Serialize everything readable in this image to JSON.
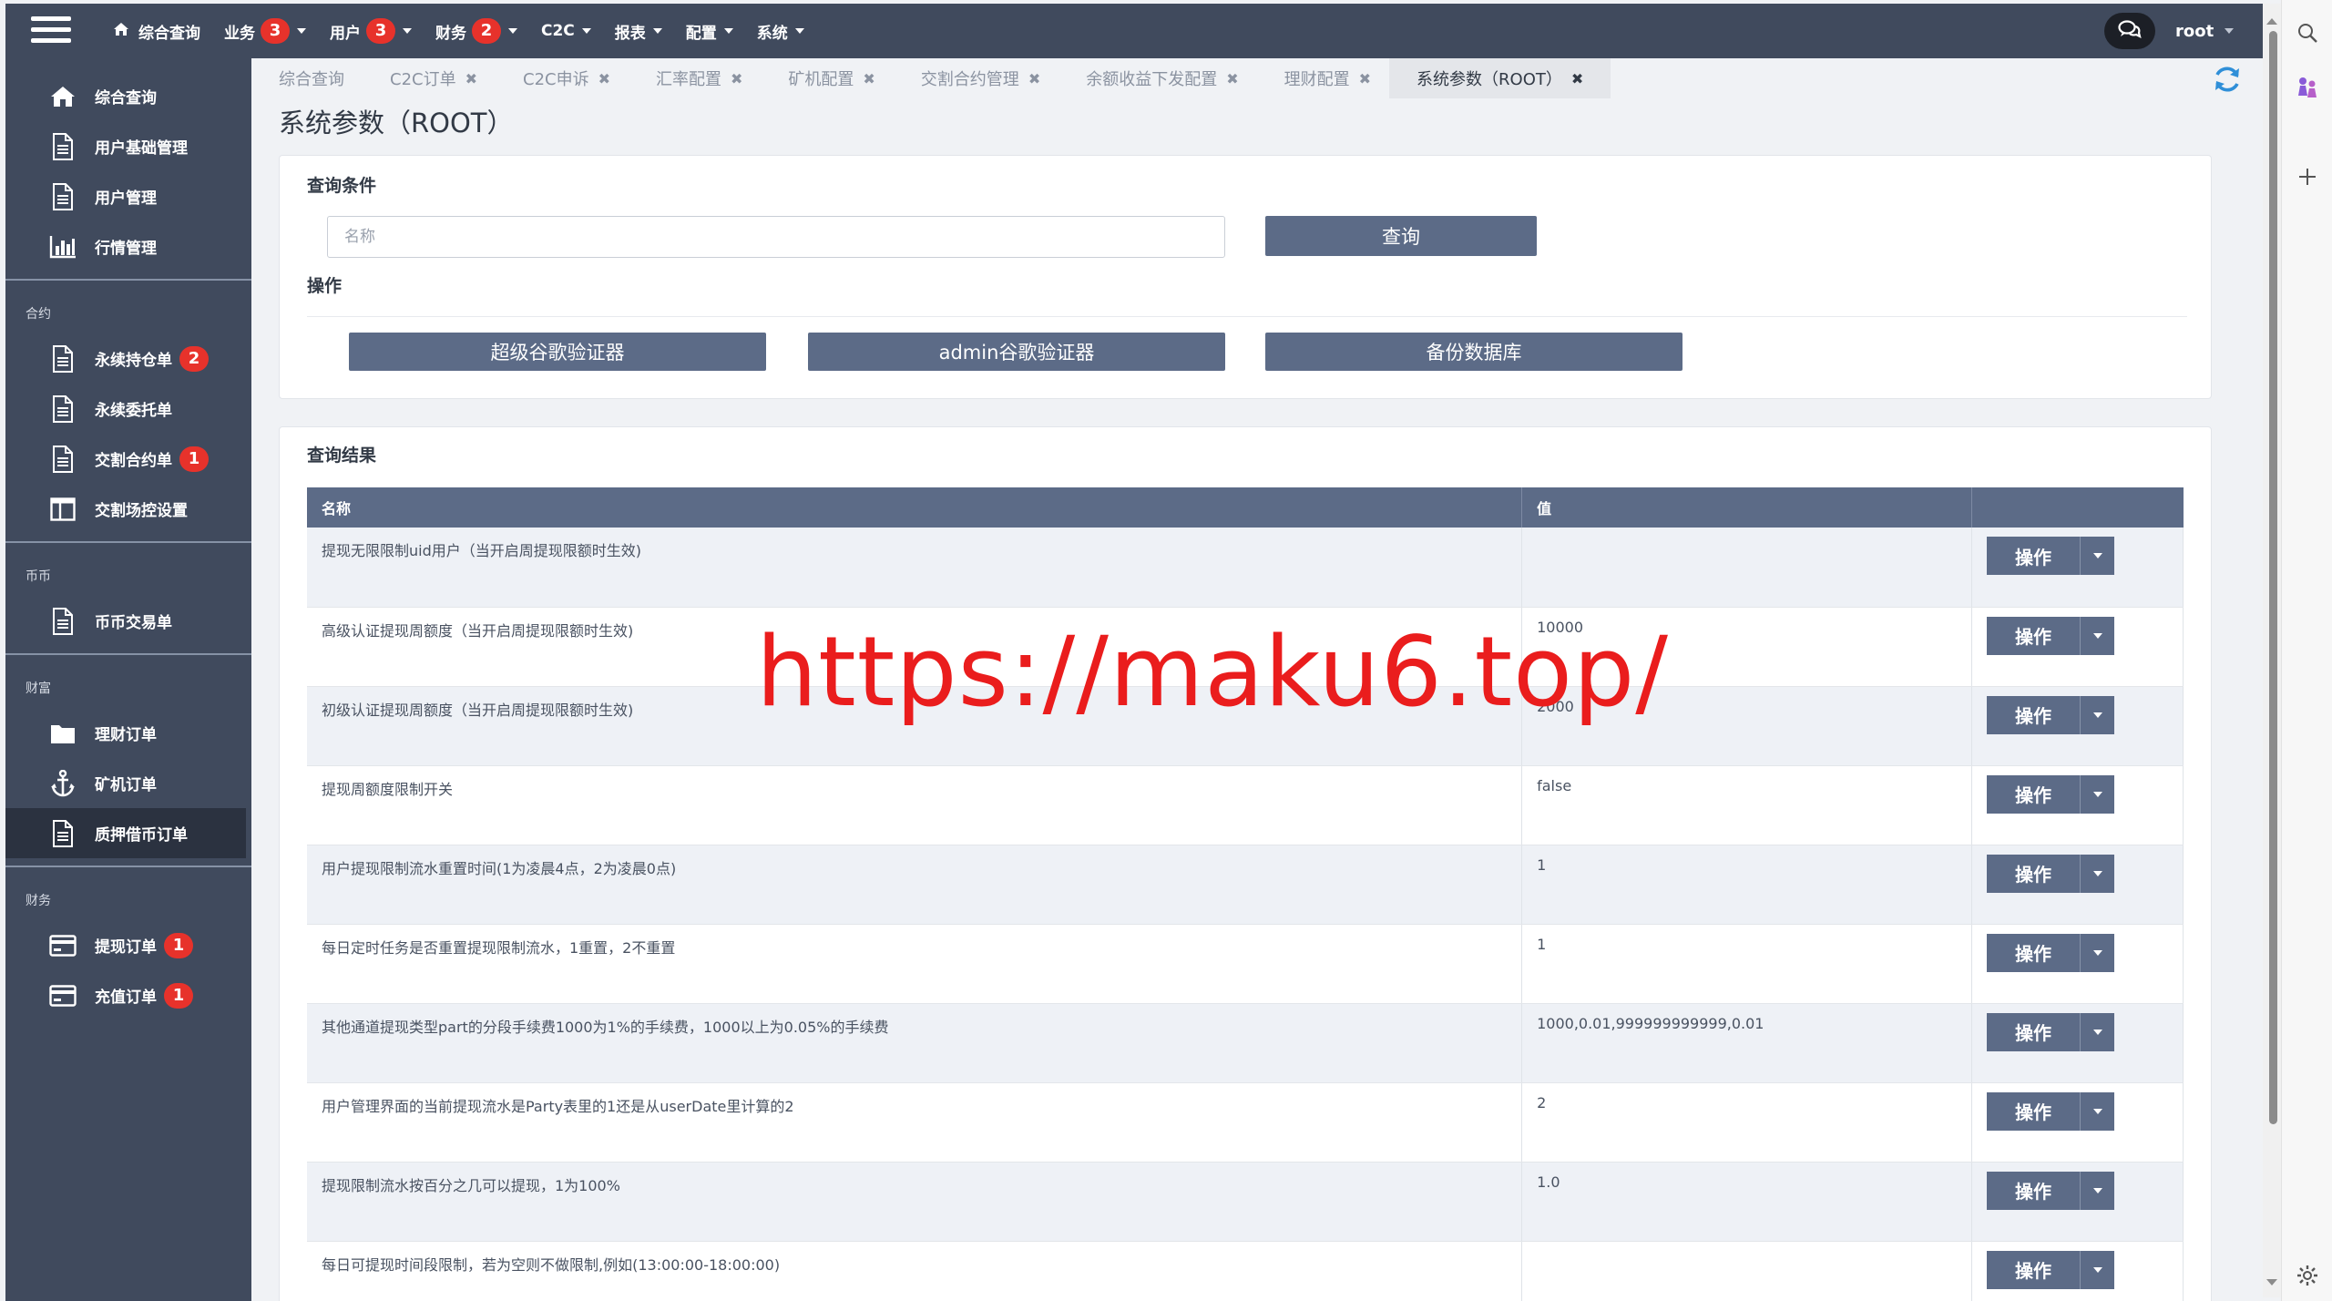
{
  "topnav": {
    "home_label": "综合查询",
    "items": [
      {
        "label": "业务",
        "badge": "3"
      },
      {
        "label": "用户",
        "badge": "3"
      },
      {
        "label": "财务",
        "badge": "2"
      },
      {
        "label": "C2C"
      },
      {
        "label": "报表"
      },
      {
        "label": "配置"
      },
      {
        "label": "系统"
      }
    ],
    "user": "root"
  },
  "sidebar": {
    "top_items": [
      {
        "label": "综合查询",
        "icon": "home-icon"
      },
      {
        "label": "用户基础管理",
        "icon": "document-icon"
      },
      {
        "label": "用户管理",
        "icon": "document-icon"
      },
      {
        "label": "行情管理",
        "icon": "bar-chart-icon"
      }
    ],
    "sections": [
      {
        "title": "合约",
        "items": [
          {
            "label": "永续持仓单",
            "icon": "document-icon",
            "badge": "2"
          },
          {
            "label": "永续委托单",
            "icon": "document-icon"
          },
          {
            "label": "交割合约单",
            "icon": "document-icon",
            "badge": "1"
          },
          {
            "label": "交割场控设置",
            "icon": "columns-icon"
          }
        ]
      },
      {
        "title": "币币",
        "items": [
          {
            "label": "币币交易单",
            "icon": "document-icon"
          }
        ]
      },
      {
        "title": "财富",
        "items": [
          {
            "label": "理财订单",
            "icon": "folder-icon"
          },
          {
            "label": "矿机订单",
            "icon": "anchor-icon"
          },
          {
            "label": "质押借币订单",
            "icon": "document-icon",
            "active": true
          }
        ]
      },
      {
        "title": "财务",
        "items": [
          {
            "label": "提现订单",
            "icon": "credit-card-icon",
            "badge": "1"
          },
          {
            "label": "充值订单",
            "icon": "credit-card-icon",
            "badge": "1"
          }
        ]
      }
    ]
  },
  "tabs": [
    {
      "label": "综合查询"
    },
    {
      "label": "C2C订单"
    },
    {
      "label": "C2C申诉"
    },
    {
      "label": "汇率配置"
    },
    {
      "label": "矿机配置"
    },
    {
      "label": "交割合约管理"
    },
    {
      "label": "余额收益下发配置"
    },
    {
      "label": "理财配置"
    },
    {
      "label": "系统参数（ROOT）",
      "active": true
    }
  ],
  "page_title": "系统参数（ROOT）",
  "query": {
    "title": "查询条件",
    "name_placeholder": "名称",
    "name_value": "",
    "search_label": "查询",
    "ops_title": "操作",
    "buttons": [
      "超级谷歌验证器",
      "admin谷歌验证器",
      "备份数据库"
    ]
  },
  "results": {
    "title": "查询结果",
    "columns": [
      "名称",
      "值",
      ""
    ],
    "action_label": "操作",
    "rows": [
      {
        "name": "提现无限限制uid用户（当开启周提现限额时生效)",
        "value": ""
      },
      {
        "name": "高级认证提现周额度（当开启周提现限额时生效)",
        "value": "10000"
      },
      {
        "name": "初级认证提现周额度（当开启周提现限额时生效)",
        "value": "2000"
      },
      {
        "name": "提现周额度限制开关",
        "value": "false"
      },
      {
        "name": "用户提现限制流水重置时间(1为凌晨4点，2为凌晨0点)",
        "value": "1"
      },
      {
        "name": "每日定时任务是否重置提现限制流水，1重置，2不重置",
        "value": "1"
      },
      {
        "name": "其他通道提现类型part的分段手续费1000为1%的手续费，1000以上为0.05%的手续费",
        "value": "1000,0.01,999999999999,0.01"
      },
      {
        "name": "用户管理界面的当前提现流水是Party表里的1还是从userDate里计算的2",
        "value": "2"
      },
      {
        "name": "提现限制流水按百分之几可以提现，1为100%",
        "value": "1.0"
      },
      {
        "name": "每日可提现时间段限制，若为空则不做限制,例如(13:00:00-18:00:00)",
        "value": ""
      }
    ]
  },
  "watermark": "https://maku6.top/",
  "colors": {
    "navbar": "#404a5d",
    "accent_button": "#5c6b87",
    "badge": "#e7322b",
    "refresh": "#2f8fd8",
    "watermark": "#ea1d1d"
  }
}
